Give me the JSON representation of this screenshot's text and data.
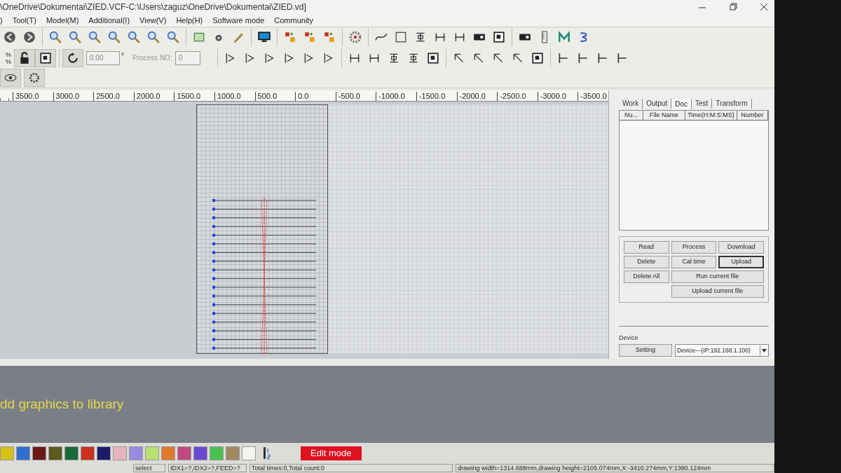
{
  "window": {
    "title": "\\OneDrive\\Dokumentai\\ZIED.VCF-C:\\Users\\zaguz\\OneDrive\\Dokumentai\\ZIED.vd]"
  },
  "menu": [
    ")",
    "Tool(T)",
    "Model(M)",
    "Additional(I)",
    "View(V)",
    "Help(H)",
    "Software mode",
    "Community"
  ],
  "toolbar": {
    "percent_top": "%",
    "percent_bottom": "%",
    "angle_value": "0.00",
    "degree": "°",
    "process_label": "Process NO:",
    "process_value": "0"
  },
  "ruler": [
    "3500.0",
    "3000.0",
    "2500.0",
    "2000.0",
    "1500.0",
    "1000.0",
    "500.0",
    "0.0",
    "-500.0",
    "-1000.0",
    "-1500.0",
    "-2000.0",
    "-2500.0",
    "-3000.0",
    "-3500.0"
  ],
  "panel": {
    "tabs": [
      {
        "label": "Work",
        "selected": false
      },
      {
        "label": "Output",
        "selected": false
      },
      {
        "label": "Doc",
        "selected": true
      },
      {
        "label": "Test",
        "selected": false
      },
      {
        "label": "Transform",
        "selected": false
      }
    ],
    "columns": [
      "Nu...",
      "File Name",
      "Time(H:M:S:MS)",
      "Number"
    ],
    "buttons": [
      {
        "label": "Read",
        "focused": false
      },
      {
        "label": "Process",
        "focused": false
      },
      {
        "label": "Download",
        "focused": false
      },
      {
        "label": "Delete",
        "focused": false
      },
      {
        "label": "Cal time",
        "focused": false
      },
      {
        "label": "Upload",
        "focused": true
      },
      {
        "label": "Delete All",
        "focused": false
      },
      {
        "label": "Run current file",
        "focused": false
      },
      {
        "label": "Upload current file",
        "focused": false
      }
    ],
    "device": {
      "title": "Device",
      "setting": "Setting",
      "selected_device": "Device—(IP:192.168.1.100)"
    }
  },
  "message": "dd graphics to library",
  "palette": [
    {
      "color": "#d4c21a"
    },
    {
      "color": "#2f6fd0"
    },
    {
      "color": "#6b1a1a"
    },
    {
      "color": "#5a5a1e"
    },
    {
      "color": "#1a6a3a"
    },
    {
      "color": "#c8321e"
    },
    {
      "color": "#1e1a6a"
    },
    {
      "color": "#e8b4c0"
    },
    {
      "color": "#9a8ae0"
    },
    {
      "color": "#b8e070"
    },
    {
      "color": "#e07830"
    },
    {
      "color": "#c04a80"
    },
    {
      "color": "#6a4ad0"
    },
    {
      "color": "#4ac050"
    },
    {
      "color": "#a08a60"
    },
    {
      "color": "#f4f4ee"
    }
  ],
  "edit_mode": "Edit mode",
  "status_bar": [
    "select",
    "IDX1=?,IDX2=?,FEED=?",
    "Total times:0,Total count:0",
    "drawing width=1314.688mm,drawing height=2105.074mm,X:-3410.274mm,Y:1380.124mm"
  ]
}
